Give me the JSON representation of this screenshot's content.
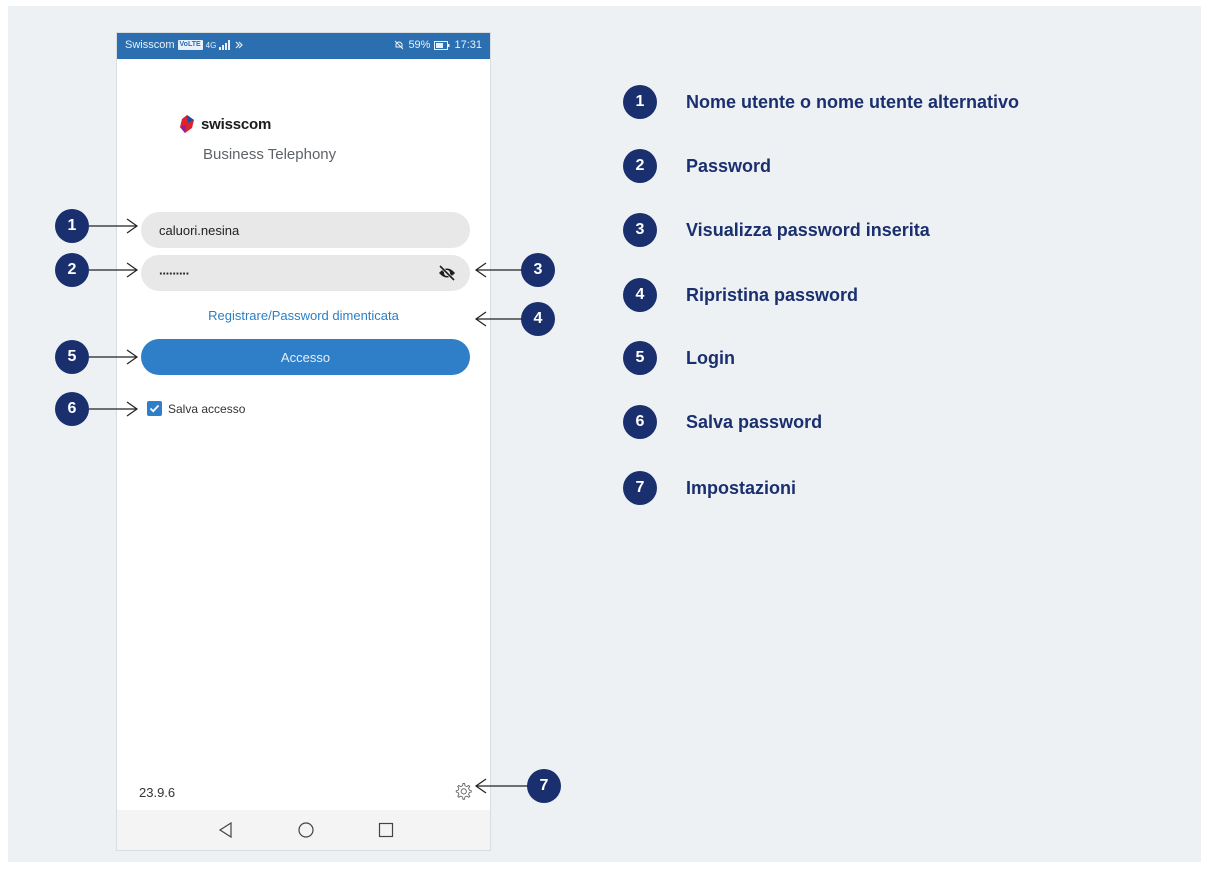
{
  "status_bar": {
    "carrier": "Swisscom",
    "volte": "VoLTE",
    "network": "4G",
    "battery": "59%",
    "time": "17:31"
  },
  "brand": {
    "logo_text": "swisscom",
    "app_subtitle": "Business Telephony",
    "accent_color": "#2f7fc8",
    "badge_color": "#1a2f6e"
  },
  "login_form": {
    "username_value": "caluori.nesina",
    "password_value": "·········",
    "password_toggle_icon": "eye-off-icon",
    "forgot_link": "Registrare/Password dimenticata",
    "login_button": "Accesso",
    "save_login_label": "Salva accesso",
    "save_login_checked": true
  },
  "footer": {
    "version": "23.9.6",
    "settings_icon": "gear-icon"
  },
  "nav_bar": [
    "back-icon",
    "home-icon",
    "recents-icon"
  ],
  "callouts": [
    "1",
    "2",
    "3",
    "4",
    "5",
    "6",
    "7"
  ],
  "legend": [
    {
      "number": "1",
      "label": "Nome utente o nome utente alternativo"
    },
    {
      "number": "2",
      "label": "Password"
    },
    {
      "number": "3",
      "label": "Visualizza password inserita"
    },
    {
      "number": "4",
      "label": "Ripristina password"
    },
    {
      "number": "5",
      "label": "Login"
    },
    {
      "number": "6",
      "label": "Salva password"
    },
    {
      "number": "7",
      "label": "Impostazioni"
    }
  ]
}
